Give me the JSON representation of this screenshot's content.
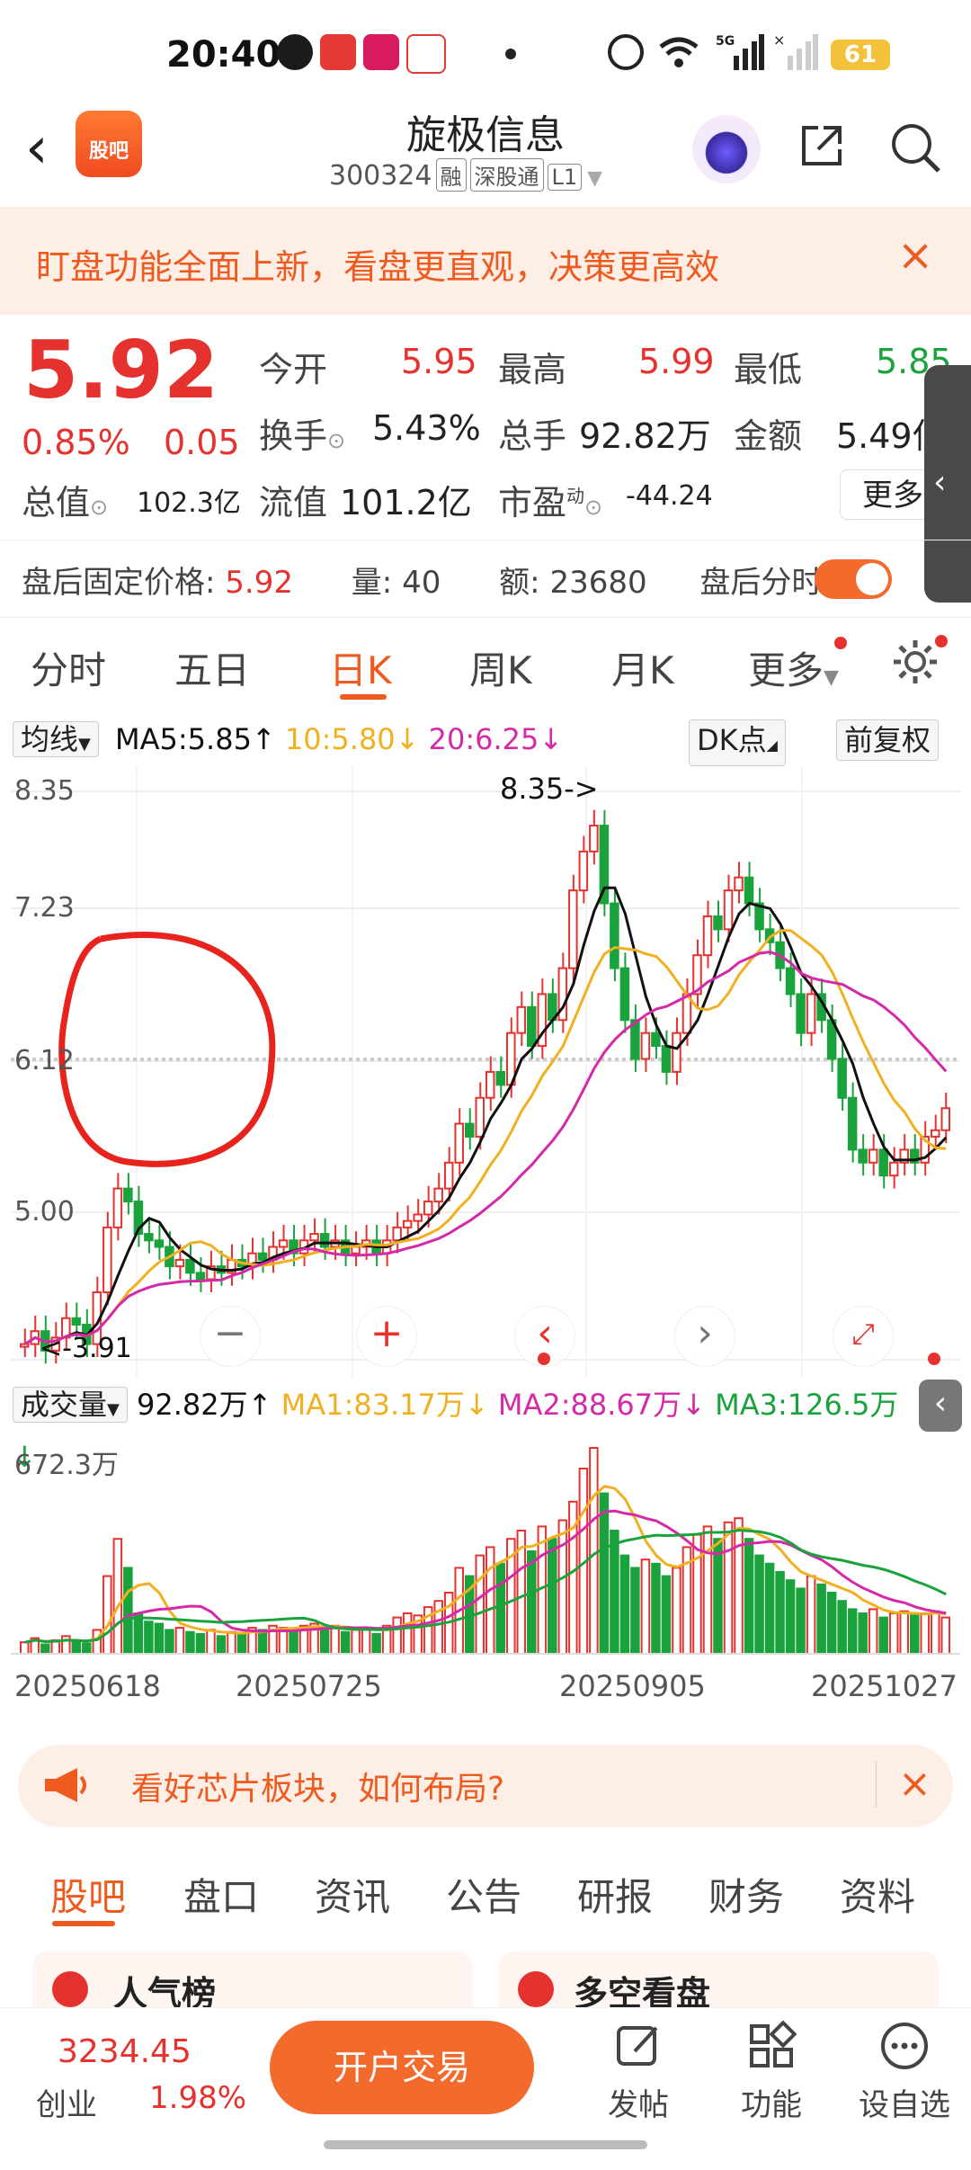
{
  "status_bar": {
    "time": "20:40",
    "battery": "61"
  },
  "header": {
    "logo_text": "股吧",
    "title": "旋极信息",
    "code": "300324",
    "tags": [
      "融",
      "深股通",
      "L1"
    ]
  },
  "banner": {
    "text": "盯盘功能全面上新，看盘更直观，决策更高效",
    "close": "×"
  },
  "quote": {
    "price": "5.92",
    "change_pct": "0.85%",
    "change": "0.05",
    "open_label": "今开",
    "open": "5.95",
    "high_label": "最高",
    "high": "5.99",
    "low_label": "最低",
    "low": "5.85",
    "turnover_label": "换手",
    "turnover": "5.43%",
    "volume_label": "总手",
    "volume": "92.82万",
    "amount_label": "金额",
    "amount": "5.49亿",
    "mcap_label": "总值",
    "mcap": "102.3亿",
    "float_label": "流值",
    "float": "101.2亿",
    "pe_label": "市盈",
    "pe_sup": "动",
    "pe": "-44.24",
    "more": "更多"
  },
  "after_hours": {
    "price_label": "盘后固定价格:",
    "price": "5.92",
    "vol_label": "量:",
    "vol": "40",
    "amt_label": "额:",
    "amt": "23680",
    "toggle_label": "盘后分时"
  },
  "kline_tabs": [
    "分时",
    "五日",
    "日K",
    "周K",
    "月K",
    "更多"
  ],
  "ma_bar": {
    "selector": "均线",
    "ma5": "MA5:5.85↑",
    "ma10": "10:5.80↓",
    "ma20": "20:6.25↓",
    "dk": "DK点",
    "adjust": "前复权"
  },
  "price_axis": [
    "8.35",
    "7.23",
    "6.12",
    "5.00"
  ],
  "price_annotations": {
    "high_note": "8.35->",
    "low_note": "<-3.91"
  },
  "volume_bar": {
    "selector": "成交量",
    "vol": "92.82万↑",
    "ma1": "MA1:83.17万↓",
    "ma2": "MA2:88.67万↓",
    "ma3": "MA3:126.5万↓",
    "max_label": "672.3万"
  },
  "date_axis": [
    "20250618",
    "20250725",
    "20250905",
    "20251027"
  ],
  "promo": {
    "text": "看好芯片板块，如何布局?"
  },
  "bottom_tabs": [
    "股吧",
    "盘口",
    "资讯",
    "公告",
    "研报",
    "财务",
    "资料"
  ],
  "peek": {
    "left": "人气榜",
    "right": "多空看盘"
  },
  "bottom_bar": {
    "index_value": "3234.45",
    "index_name": "创业",
    "index_change": "1.98%",
    "trade_button": "开户交易",
    "post": "发帖",
    "functions": "功能",
    "watchlist": "设自选"
  },
  "colors": {
    "up": "#e6322e",
    "down": "#1aa33c",
    "accent": "#f26b2c",
    "ma5": "#111111",
    "ma10": "#f0b020",
    "ma20": "#d42aa8"
  }
}
